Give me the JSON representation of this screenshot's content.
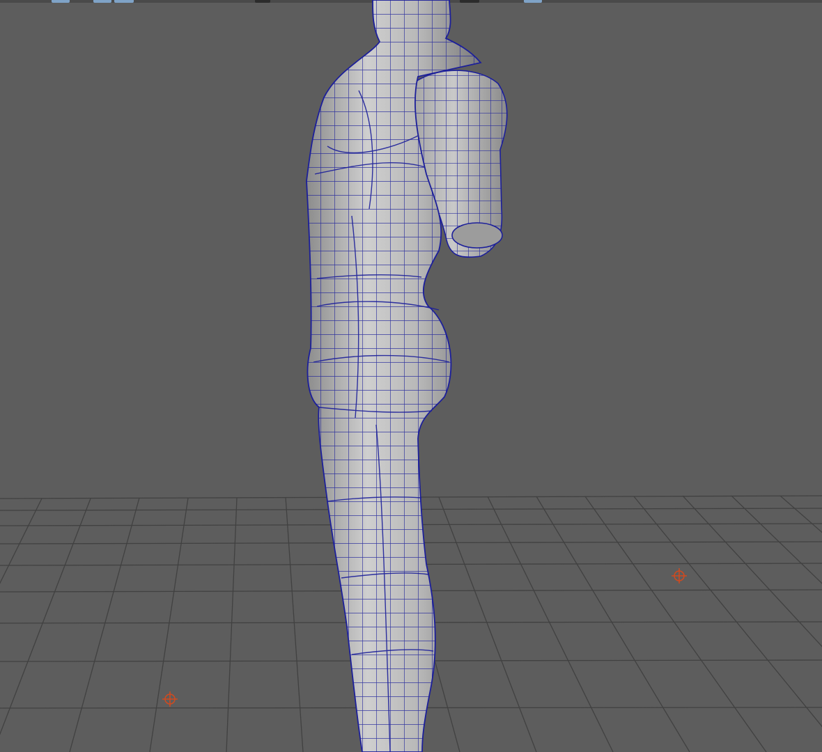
{
  "viewport": {
    "panel": "perspective-viewport",
    "background_color": "#5d5d5d",
    "grid_color": "#414141",
    "wireframe_color": "#1c1f9a",
    "mesh_shade_color": "#a8a8a8",
    "locator_color": "#d24a1e"
  },
  "toolbar": {
    "icons": [
      "view-tool-icon",
      "layout-icon",
      "camera-icon",
      "display-icon",
      "shading-icon"
    ]
  },
  "scene": {
    "object": "character-mesh",
    "locators": [
      "locator-1",
      "locator-2"
    ]
  }
}
